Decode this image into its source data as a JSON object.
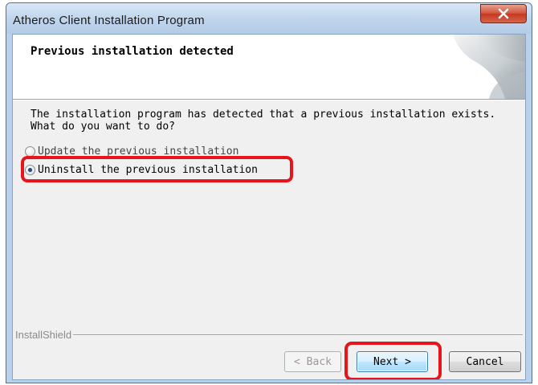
{
  "window": {
    "title": "Atheros Client Installation Program",
    "close_icon": "close-icon"
  },
  "header": {
    "title": "Previous installation detected",
    "graphic": "swoosh-graphic"
  },
  "main": {
    "description": "The installation program has detected that a previous installation exists.\nWhat do you want to do?",
    "options": [
      {
        "label": "Update the previous installation",
        "checked": false
      },
      {
        "label": "Uninstall the previous installation",
        "checked": true
      }
    ]
  },
  "footer": {
    "brand": "InstallShield",
    "back_label": "< Back",
    "next_label": "Next >",
    "cancel_label": "Cancel"
  },
  "colors": {
    "highlight": "#e8141b",
    "frame": "#b9d1ea",
    "dialog_bg": "#f0f0f0"
  }
}
